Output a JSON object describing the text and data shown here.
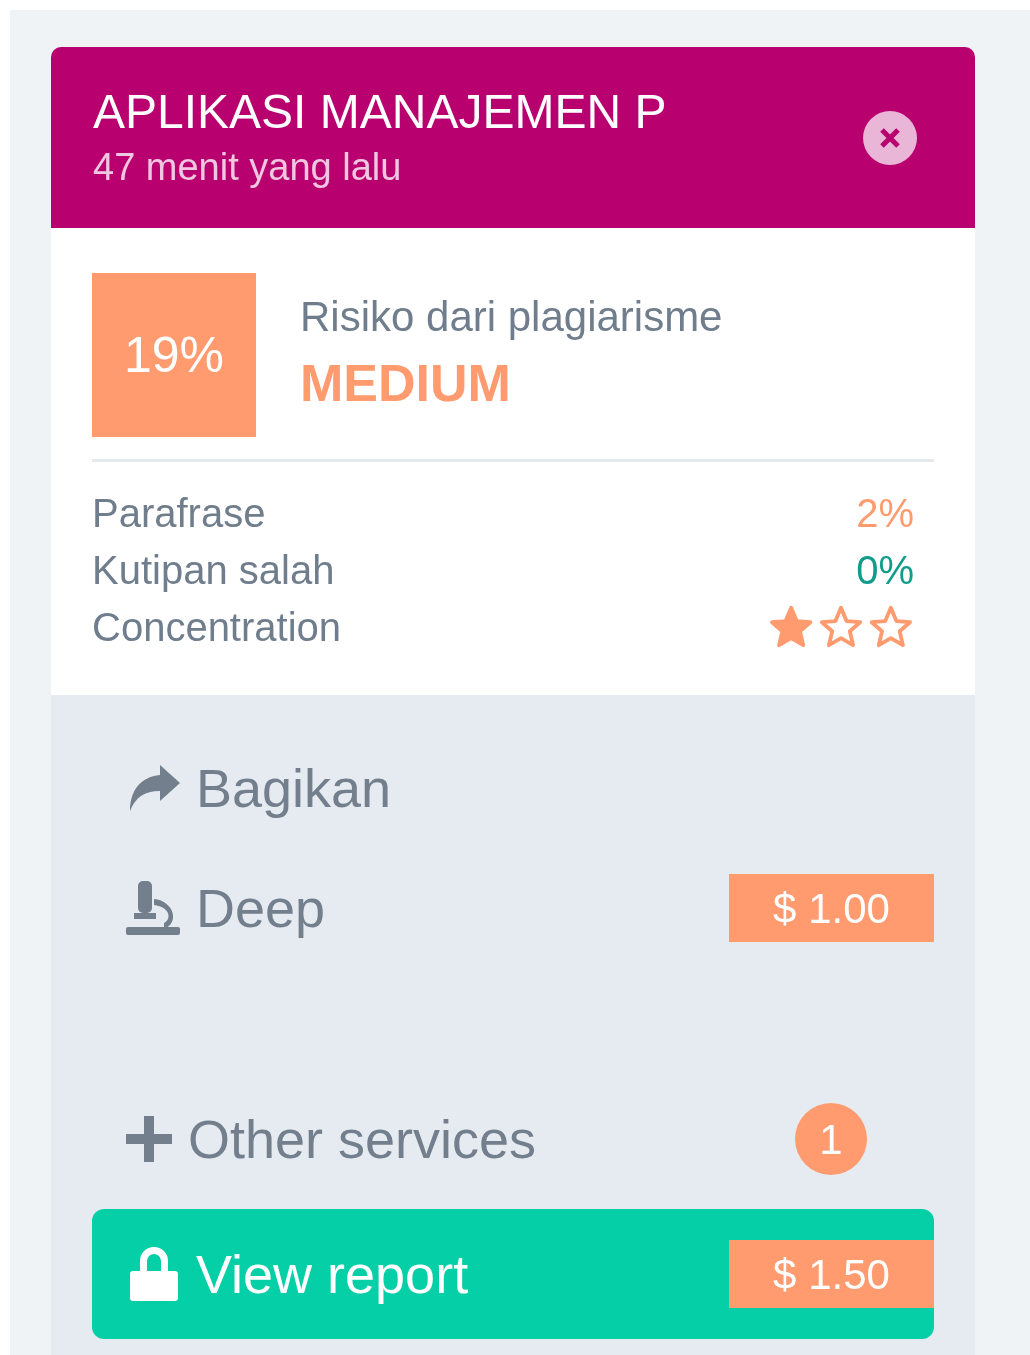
{
  "header": {
    "title": "APLIKASI MANAJEMEN P",
    "subtitle": "47 menit yang lalu"
  },
  "score": {
    "percent": "19%",
    "label": "Risiko dari plagiarisme",
    "risk": "MEDIUM"
  },
  "metrics": [
    {
      "label": "Parafrase",
      "kind": "value",
      "value": "2%",
      "color": "#ff9b6e"
    },
    {
      "label": "Kutipan salah",
      "kind": "value",
      "value": "0%",
      "color": "#129c8c"
    },
    {
      "label": "Concentration",
      "kind": "stars",
      "stars": 1
    }
  ],
  "actions": [
    {
      "kind": "share",
      "label": "Bagikan"
    },
    {
      "kind": "deep",
      "label": "Deep",
      "price": "$ 1.00"
    },
    {
      "kind": "other",
      "label": "Other services",
      "badge": "1"
    }
  ],
  "report_button": {
    "label": "View report",
    "price": "$ 1.50"
  }
}
